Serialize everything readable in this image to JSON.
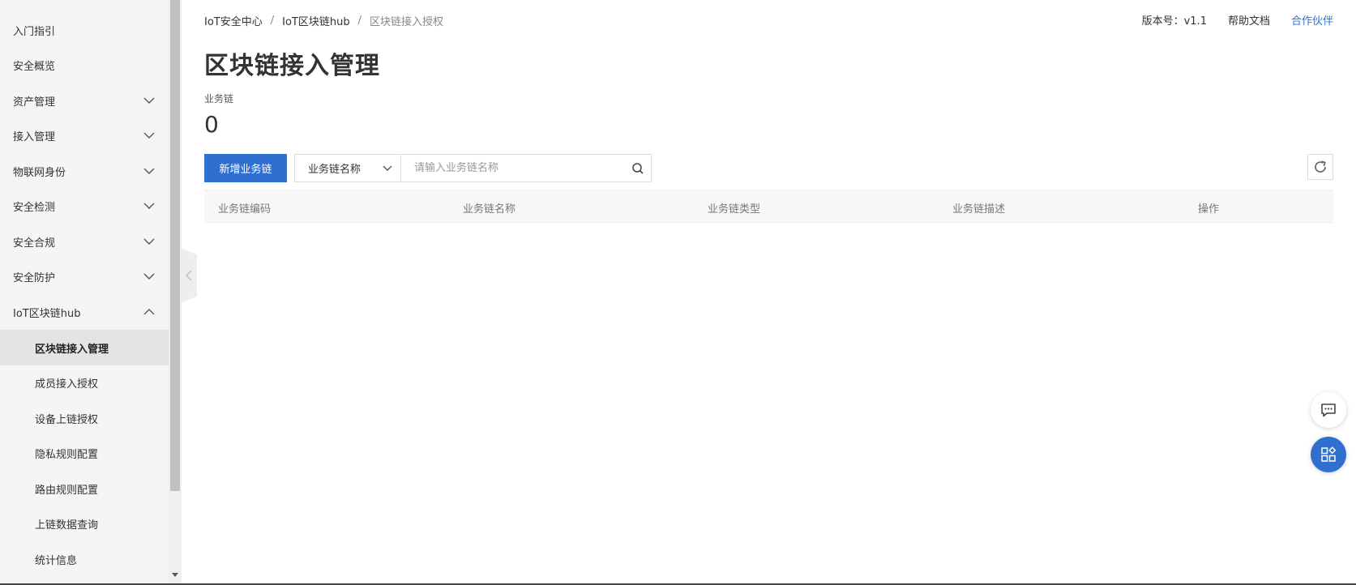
{
  "sidebar": {
    "items": [
      {
        "label": "入门指引",
        "expandable": false
      },
      {
        "label": "安全概览",
        "expandable": false
      },
      {
        "label": "资产管理",
        "expandable": true
      },
      {
        "label": "接入管理",
        "expandable": true
      },
      {
        "label": "物联网身份",
        "expandable": true
      },
      {
        "label": "安全检测",
        "expandable": true
      },
      {
        "label": "安全合规",
        "expandable": true
      },
      {
        "label": "安全防护",
        "expandable": true
      },
      {
        "label": "IoT区块链hub",
        "expandable": true,
        "expanded": true
      }
    ],
    "sub_items": [
      {
        "label": "区块链接入管理",
        "active": true
      },
      {
        "label": "成员接入授权"
      },
      {
        "label": "设备上链授权"
      },
      {
        "label": "隐私规则配置"
      },
      {
        "label": "路由规则配置"
      },
      {
        "label": "上链数据查询"
      },
      {
        "label": "统计信息"
      }
    ]
  },
  "breadcrumb": {
    "items": [
      "IoT安全中心",
      "IoT区块链hub",
      "区块链接入授权"
    ],
    "separator": "/"
  },
  "top_links": {
    "version": "版本号：v1.1",
    "help": "帮助文档",
    "partner": "合作伙伴"
  },
  "page": {
    "title": "区块链接入管理",
    "stat_label": "业务链",
    "stat_value": "0"
  },
  "toolbar": {
    "add_button": "新增业务链",
    "filter_select": "业务链名称",
    "search_placeholder": "请输入业务链名称"
  },
  "table": {
    "columns": [
      "业务链编码",
      "业务链名称",
      "业务链类型",
      "业务链描述",
      "操作"
    ]
  },
  "colors": {
    "primary": "#2f6fcf",
    "sidebar_bg": "#f5f5f5",
    "active_bg": "#e4e4e4"
  }
}
